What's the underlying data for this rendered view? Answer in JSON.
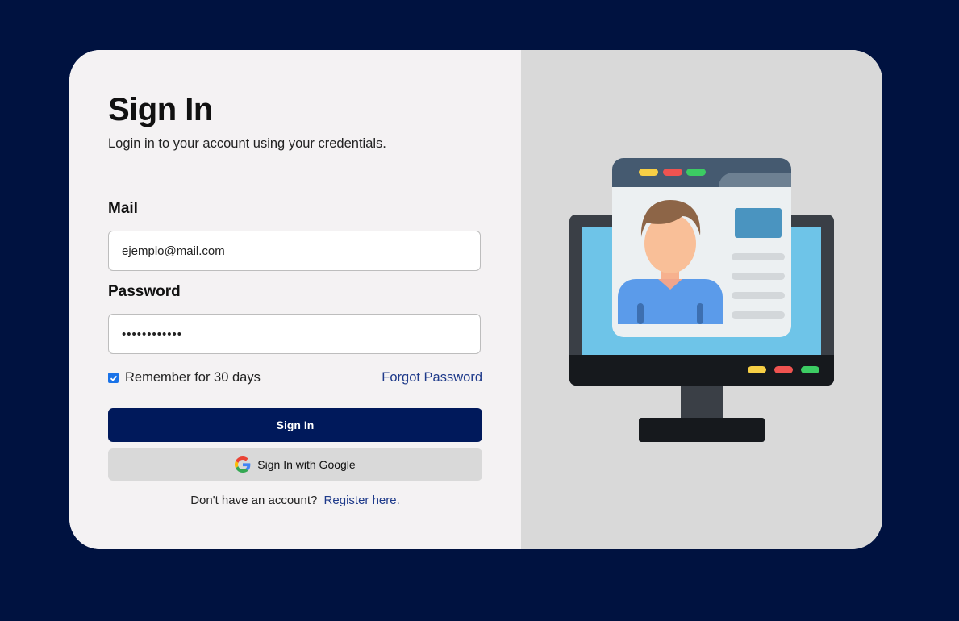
{
  "form": {
    "title": "Sign In",
    "subtitle": "Login in to your account using your credentials.",
    "mail_label": "Mail",
    "mail_value": "ejemplo@mail.com",
    "password_label": "Password",
    "password_value": "••••••••••••",
    "remember_label": "Remember for 30 days",
    "remember_checked": true,
    "forgot_label": "Forgot Password",
    "signin_label": "Sign In",
    "google_label": "Sign In with Google",
    "register_prompt": "Don't have an account?",
    "register_link": "Register here."
  },
  "colors": {
    "background": "#001240",
    "card_left": "#f4f2f3",
    "card_right": "#d9d9d9",
    "primary_button": "#00195b",
    "link": "#1e3a8a"
  },
  "illustration": {
    "icon": "computer-profile-illustration"
  }
}
